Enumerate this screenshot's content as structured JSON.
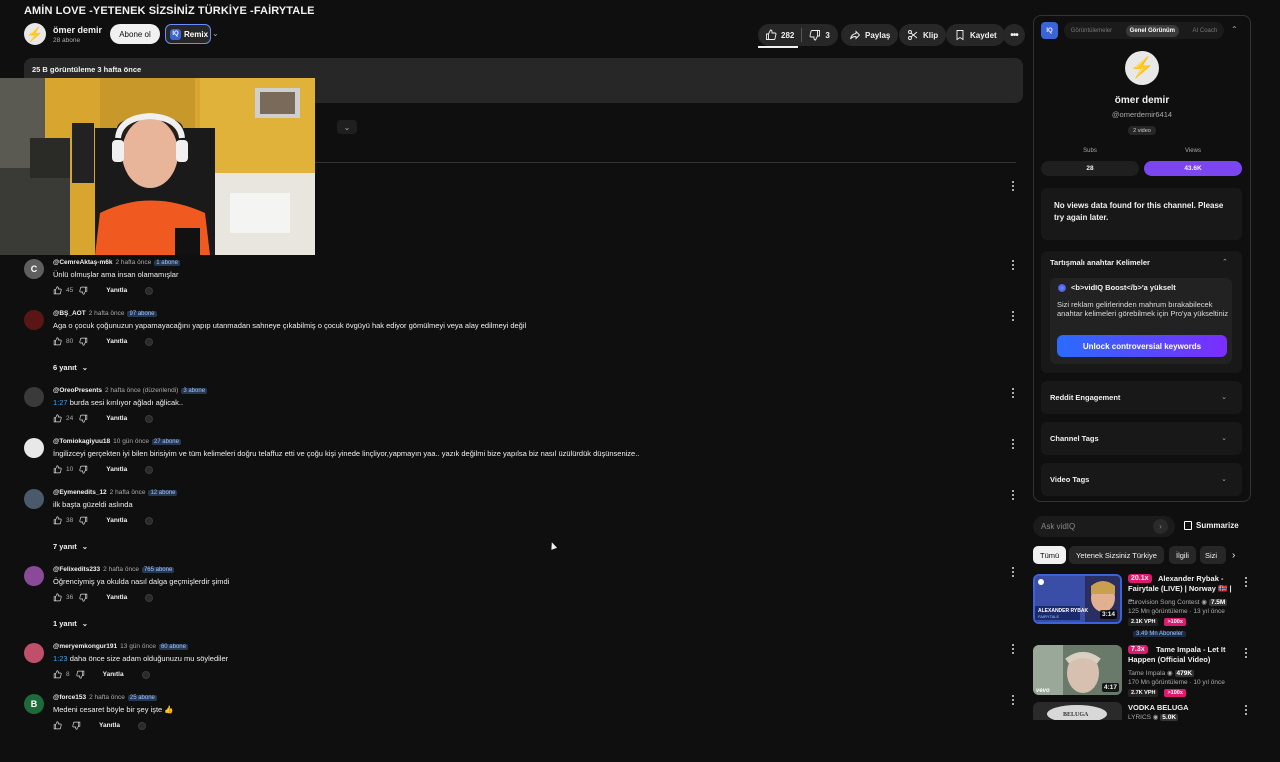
{
  "video": {
    "title": "AMİN LOVE -YETENEK SİZSİNİZ TÜRKİYE -FAİRYTALE",
    "channel_name": "ömer demir",
    "channel_subs": "28 abone",
    "subscribe_label": "Abone ol",
    "remix_label": "Remix",
    "likes": "282",
    "dislikes": "3",
    "share_label": "Paylaş",
    "clip_label": "Klip",
    "save_label": "Kaydet",
    "description_meta": "25 B görüntüleme  3 hafta önce"
  },
  "comments": [
    {
      "user": "@CemreAktaş-m6k",
      "time": "2 hafta önce",
      "badge": "1 abone",
      "text": "Ünlü olmuşlar ama insan olamamışlar",
      "likes": "45",
      "avatar_letter": "C",
      "avatar_color": "#5f5f5f",
      "replies": ""
    },
    {
      "user": "@BŞ_AOT",
      "time": "2 hafta önce",
      "badge": "97 abone",
      "text": "Aga o çocuk çoğunuzun yapamayacağını yapıp utanmadan sahneye çıkabilmiş o çocuk övgüyü hak ediyor gömülmeyi veya alay edilmeyi değil",
      "likes": "80",
      "avatar_letter": "",
      "avatar_color": "#5a1515",
      "replies": "6 yanıt"
    },
    {
      "user": "@OreoPresents",
      "time": "2 hafta önce (düzenlendi)",
      "badge": "3 abone",
      "timestamp": "1:27",
      "text": " burda sesi kırılıyor ağladı ağlicak..",
      "likes": "24",
      "avatar_letter": "",
      "avatar_color": "#3a3a3a",
      "replies": ""
    },
    {
      "user": "@Tomiokagiyuu18",
      "time": "10 gün önce",
      "badge": "27 abone",
      "text": "İngilizceyi gerçekten iyi bilen birisiyim ve tüm kelimeleri doğru telaffuz etti ve çoğu kişi yinede linçliyor,yapmayın yaa.. yazık değilmi bize yapılsa biz nasıl üzülürdük düşünsenize..",
      "likes": "10",
      "avatar_letter": "",
      "avatar_color": "#e8e8e8",
      "replies": ""
    },
    {
      "user": "@Eymenedits_12",
      "time": "2 hafta önce",
      "badge": "12 abone",
      "text": "ilk başta güzeldi aslında",
      "likes": "38",
      "avatar_letter": "",
      "avatar_color": "#4a5a6a",
      "replies": "7 yanıt"
    },
    {
      "user": "@Felixedits233",
      "time": "2 hafta önce",
      "badge": "765 abone",
      "text": "Öğrenciymiş ya okulda nasıl dalga geçmişlerdir şimdi",
      "likes": "36",
      "avatar_letter": "",
      "avatar_color": "#8a4a9a",
      "replies": "1 yanıt"
    },
    {
      "user": "@meryemkongur191",
      "time": "13 gün önce",
      "badge": "60 abone",
      "timestamp": "1:23",
      "text": " daha önce size adam olduğunuzu mu söylediler",
      "likes": "8",
      "avatar_letter": "",
      "avatar_color": "#c0506a",
      "replies": ""
    },
    {
      "user": "@force153",
      "time": "2 hafta önce",
      "badge": "25 abone",
      "text": "Medeni cesaret böyle bir şey işte 👍",
      "likes": "",
      "avatar_letter": "B",
      "avatar_color": "#1e6b3a",
      "replies": ""
    }
  ],
  "reply_label": "Yanıtla",
  "vidiq": {
    "logo": "IQ",
    "tabs": [
      "Görüntülemeler",
      "Genel Görünüm",
      "AI Coach"
    ],
    "active_tab": "Genel Görünüm",
    "channel_name": "ömer demir",
    "handle": "@omerdemir6414",
    "videos": "2 video",
    "subs_label": "Subs",
    "subs_value": "28",
    "views_label": "Views",
    "views_value": "43.6K",
    "no_data": "No views data found for this channel. Please try again later.",
    "keywords_title": "Tartışmalı anahtar Kelimeler",
    "boost_title": "<b>vidIQ Boost</b>'a yükselt",
    "boost_desc": "Sizi reklam gelirlerinden mahrum bırakabilecek anahtar kelimeleri görebilmek için Pro'ya yükseltiniz",
    "unlock_label": "Unlock controversial keywords",
    "sections": [
      "Reddit Engagement",
      "Channel Tags",
      "Video Tags"
    ],
    "ask_placeholder": "Ask vidIQ",
    "summarize_label": "Summarize"
  },
  "chips": [
    "Tümü",
    "Yetenek Sizsiniz Türkiye",
    "İlgili",
    "Sizi"
  ],
  "related": [
    {
      "multiplier": "20.1x",
      "title": "Alexander Rybak - Fairytale (LIVE) | Norway 🇳🇴 | ...",
      "channel": "Eurovision Song Contest",
      "channel_badge": "7.5M",
      "views": "125 Mn görüntüleme · 13 yıl önce",
      "vph": "2.1K VPH",
      "pct": ">100x",
      "duration": "3:14",
      "subs_note": "3.49 Mn Aboneler"
    },
    {
      "multiplier": "7.3x",
      "title": "Tame Impala - Let It Happen (Official Video)",
      "channel": "Tame Impala",
      "channel_badge": "479K",
      "views": "170 Mn görüntüleme · 10 yıl önce",
      "vph": "2.7K VPH",
      "pct": ">100x",
      "duration": "4:17"
    },
    {
      "multiplier": "",
      "title": "VODKA BELUGA",
      "channel": "LYRICS",
      "channel_badge": "5.0K",
      "views": "",
      "vph": "",
      "pct": "",
      "duration": ""
    }
  ],
  "colors": {
    "accent_purple": "#7b46f0",
    "vph_pink": "#e0196e",
    "link_blue": "#3ea6ff"
  }
}
